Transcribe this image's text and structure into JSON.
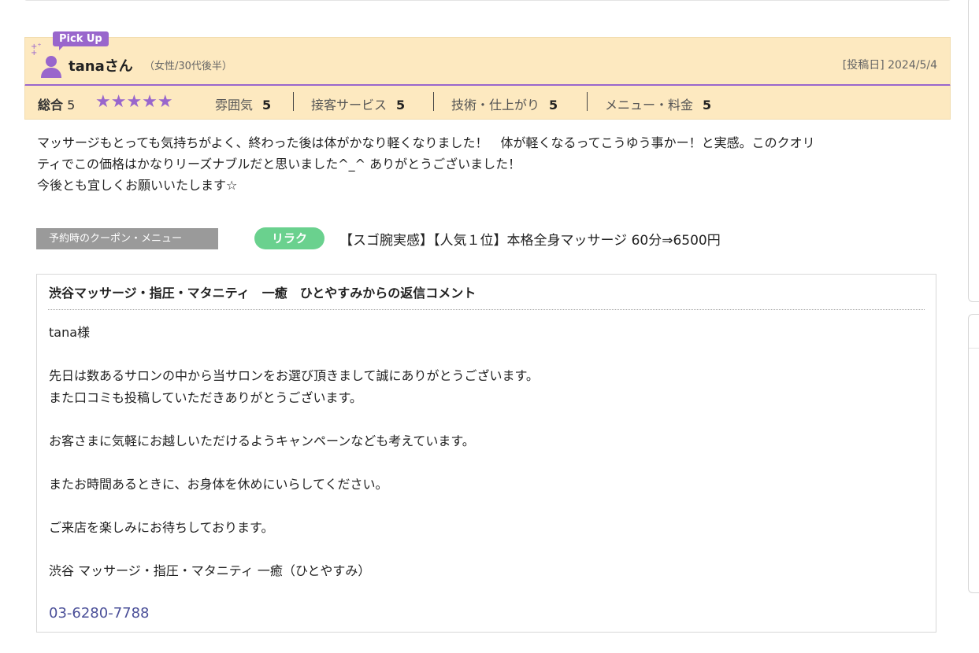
{
  "review": {
    "pickup_label": "Pick Up",
    "username": "tanaさん",
    "user_meta": "（女性/30代後半）",
    "post_date": "[投稿日] 2024/5/4",
    "overall_label": "総合",
    "overall_score": "5",
    "stars": "★★★★★",
    "ratings": [
      {
        "label": "雰囲気",
        "score": "5"
      },
      {
        "label": "接客サービス",
        "score": "5"
      },
      {
        "label": "技術・仕上がり",
        "score": "5"
      },
      {
        "label": "メニュー・料金",
        "score": "5"
      }
    ],
    "body_lines": [
      "マッサージもとっても気持ちがよく、終わった後は体がかなり軽くなりました！　体が軽くなるってこうゆう事かー！と実感。このクオリ",
      "ティでこの価格はかなりリーズナブルだと思いました^_^ ありがとうございました！",
      "今後とも宜しくお願いいたします☆"
    ],
    "coupon_tag": "予約時のクーポン・メニュー",
    "coupon_badge": "リラク",
    "coupon_name": "【スゴ腕実感】【人気１位】本格全身マッサージ 60分⇒6500円"
  },
  "reply": {
    "title": "渋谷マッサージ・指圧・マタニティ　一癒　ひとやすみからの返信コメント",
    "lines": [
      "tana様",
      "",
      "先日は数あるサロンの中から当サロンをお選び頂きまして誠にありがとうございます。",
      "また口コミも投稿していただきありがとうございます。",
      "",
      "お客さまに気軽にお越しいただけるようキャンペーンなども考えています。",
      "",
      "またお時間あるときに、お身体を休めにいらしてください。",
      "",
      "ご来店を楽しみにお待ちしております。",
      "",
      "渋谷 マッサージ・指圧・マタニティ 一癒（ひとやすみ）"
    ],
    "phone": "03-6280-7788"
  },
  "colors": {
    "accent": "#9966cc",
    "header_bg": "#fde9c0",
    "badge_green": "#6ad18e",
    "link": "#4a4f98"
  }
}
